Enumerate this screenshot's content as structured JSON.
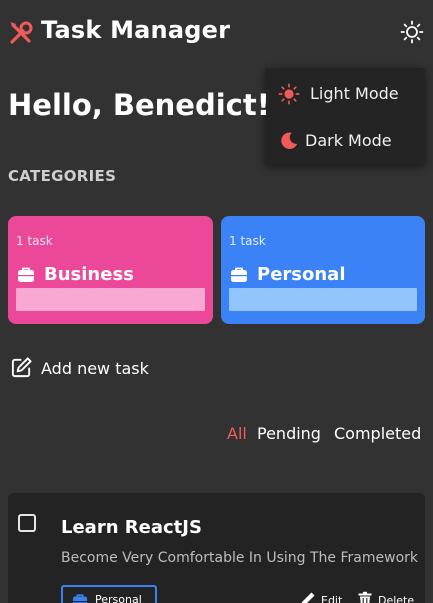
{
  "header": {
    "app_title": "Task Manager",
    "logo_icon": "tools-icon",
    "theme_toggle_icon": "sun-icon"
  },
  "theme_menu": {
    "items": [
      {
        "label": "Light Mode",
        "icon": "sun-icon"
      },
      {
        "label": "Dark Mode",
        "icon": "moon-icon"
      }
    ]
  },
  "greeting": "Hello, Benedict!",
  "categories": {
    "title": "CATEGORIES",
    "items": [
      {
        "count": "1 task",
        "name": "Business",
        "icon": "briefcase-icon",
        "color": "#ec4899",
        "bar_color": "#f9a8d4"
      },
      {
        "count": "1 task",
        "name": "Personal",
        "icon": "briefcase-icon",
        "color": "#3b82f6",
        "bar_color": "#93c5fd"
      }
    ]
  },
  "add_task": {
    "label": "Add new task",
    "icon": "edit-square-icon"
  },
  "filters": {
    "items": [
      "All",
      "Pending",
      "Completed"
    ],
    "active": "All",
    "active_color": "#f05a5a"
  },
  "tasks": [
    {
      "title": "Learn ReactJS",
      "description": "Become Very Comfortable In Using The Framework",
      "category": "Personal",
      "category_icon": "briefcase-icon",
      "category_color": "#3b82f6",
      "completed": false,
      "edit_label": "Edit",
      "delete_label": "Delete"
    }
  ],
  "colors": {
    "background": "#323232",
    "surface": "#232323",
    "accent": "#f05a5a"
  }
}
